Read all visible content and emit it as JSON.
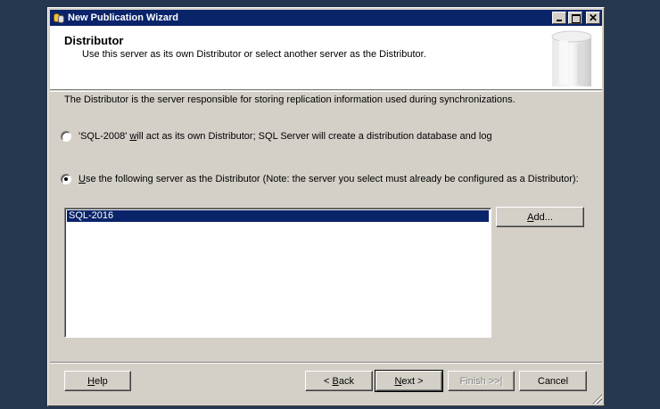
{
  "window": {
    "title": "New Publication Wizard"
  },
  "header": {
    "title": "Distributor",
    "subtitle": "Use this server as its own Distributor or select another server as the Distributor."
  },
  "intro": "The Distributor is the server responsible for storing replication information used during synchronizations.",
  "options": {
    "own_pre": "'SQL-2008' ",
    "own_mnemonic": "w",
    "own_post": "ill act as its own Distributor; SQL Server will create a distribution database and log",
    "own_checked": false,
    "other_pre": "",
    "other_mnemonic": "U",
    "other_post": "se the following server as the Distributor (Note: the server you select must already be configured as a Distributor):",
    "other_checked": true
  },
  "distributor_list": {
    "items": [
      "SQL-2016"
    ],
    "selected": "SQL-2016"
  },
  "buttons": {
    "add_mnemonic": "A",
    "add_rest": "dd...",
    "help_mnemonic": "H",
    "help_rest": "elp",
    "back_prefix": "< ",
    "back_mnemonic": "B",
    "back_rest": "ack",
    "next_mnemonic": "N",
    "next_rest": "ext >",
    "finish_label": "Finish >>|",
    "cancel_label": "Cancel"
  }
}
